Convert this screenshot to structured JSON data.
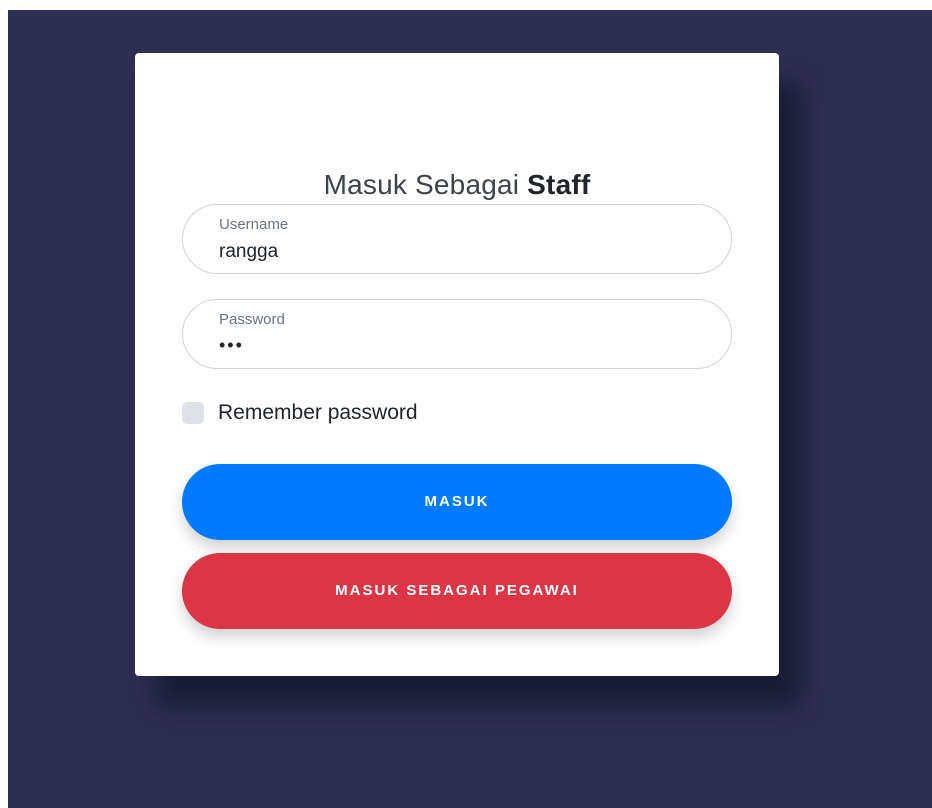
{
  "login": {
    "title_prefix": "Masuk Sebagai",
    "title_emphasis": "Staff",
    "username": {
      "label": "Username",
      "value": "rangga"
    },
    "password": {
      "label": "Password",
      "value": "•••"
    },
    "remember": {
      "label": "Remember password",
      "checked": false
    },
    "buttons": {
      "primary_label": "MASUK",
      "secondary_label": "MASUK SEBAGAI PEGAWAI"
    }
  },
  "colors": {
    "page_background": "#2e2d52",
    "card_background": "#ffffff",
    "primary_button": "#007bff",
    "secondary_button": "#dc3545",
    "checkbox_fill": "#dee2e6"
  }
}
